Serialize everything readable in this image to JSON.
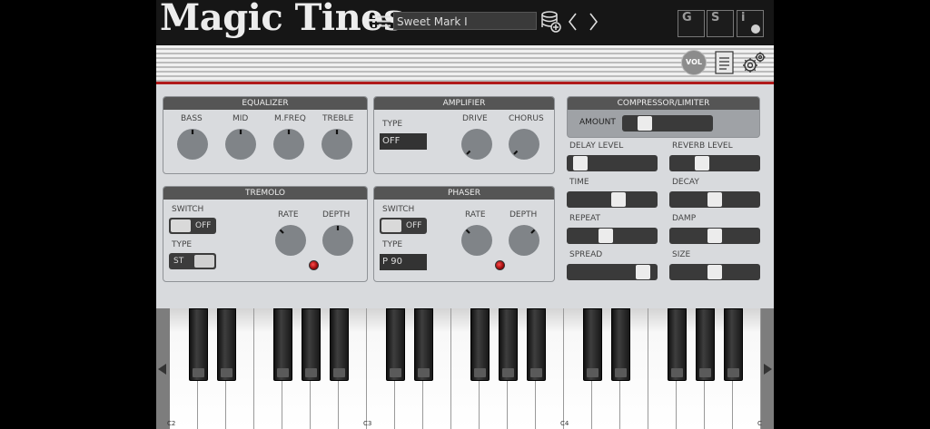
{
  "app": {
    "title": "Magic Tines"
  },
  "header": {
    "preset_name": "Sweet Mark I",
    "buttons": {
      "g": "G",
      "s": "S",
      "i": "i"
    },
    "icons": [
      "list-icon",
      "database-add-icon",
      "chevron-left-icon",
      "chevron-right-icon"
    ]
  },
  "toolbar": {
    "vol_label": "VOL",
    "icons": [
      "document-icon",
      "gear-icon"
    ]
  },
  "equalizer": {
    "title": "EQUALIZER",
    "knobs": [
      {
        "label": "BASS"
      },
      {
        "label": "MID"
      },
      {
        "label": "M.FREQ"
      },
      {
        "label": "TREBLE"
      }
    ]
  },
  "amplifier": {
    "title": "AMPLIFIER",
    "type_label": "TYPE",
    "type_value": "OFF",
    "knobs": [
      {
        "label": "DRIVE"
      },
      {
        "label": "CHORUS"
      }
    ]
  },
  "tremolo": {
    "title": "TREMOLO",
    "switch_label": "SWITCH",
    "switch_value": "OFF",
    "type_label": "TYPE",
    "type_value": "ST",
    "knobs": [
      {
        "label": "RATE"
      },
      {
        "label": "DEPTH"
      }
    ]
  },
  "phaser": {
    "title": "PHASER",
    "switch_label": "SWITCH",
    "switch_value": "OFF",
    "type_label": "TYPE",
    "type_value": "P 90",
    "knobs": [
      {
        "label": "RATE"
      },
      {
        "label": "DEPTH"
      }
    ]
  },
  "compressor": {
    "title": "COMPRESSOR/LIMITER",
    "amount_label": "AMOUNT",
    "amount_level": 0.2
  },
  "effects": {
    "delay_level": {
      "label": "DELAY LEVEL",
      "level": 0.08
    },
    "reverb_level": {
      "label": "REVERB LEVEL",
      "level": 0.33
    },
    "time": {
      "label": "TIME",
      "level": 0.58
    },
    "decay": {
      "label": "DECAY",
      "level": 0.5
    },
    "repeat": {
      "label": "REPEAT",
      "level": 0.42
    },
    "damp": {
      "label": "DAMP",
      "level": 0.5
    },
    "spread": {
      "label": "SPREAD",
      "level": 0.9
    },
    "size": {
      "label": "SIZE",
      "level": 0.5
    }
  },
  "keyboard": {
    "labels": [
      "C2",
      "C3",
      "C4",
      "C"
    ]
  },
  "colors": {
    "accent_red": "#b01a1a",
    "panel": "#d9dbde",
    "header": "#161616"
  }
}
